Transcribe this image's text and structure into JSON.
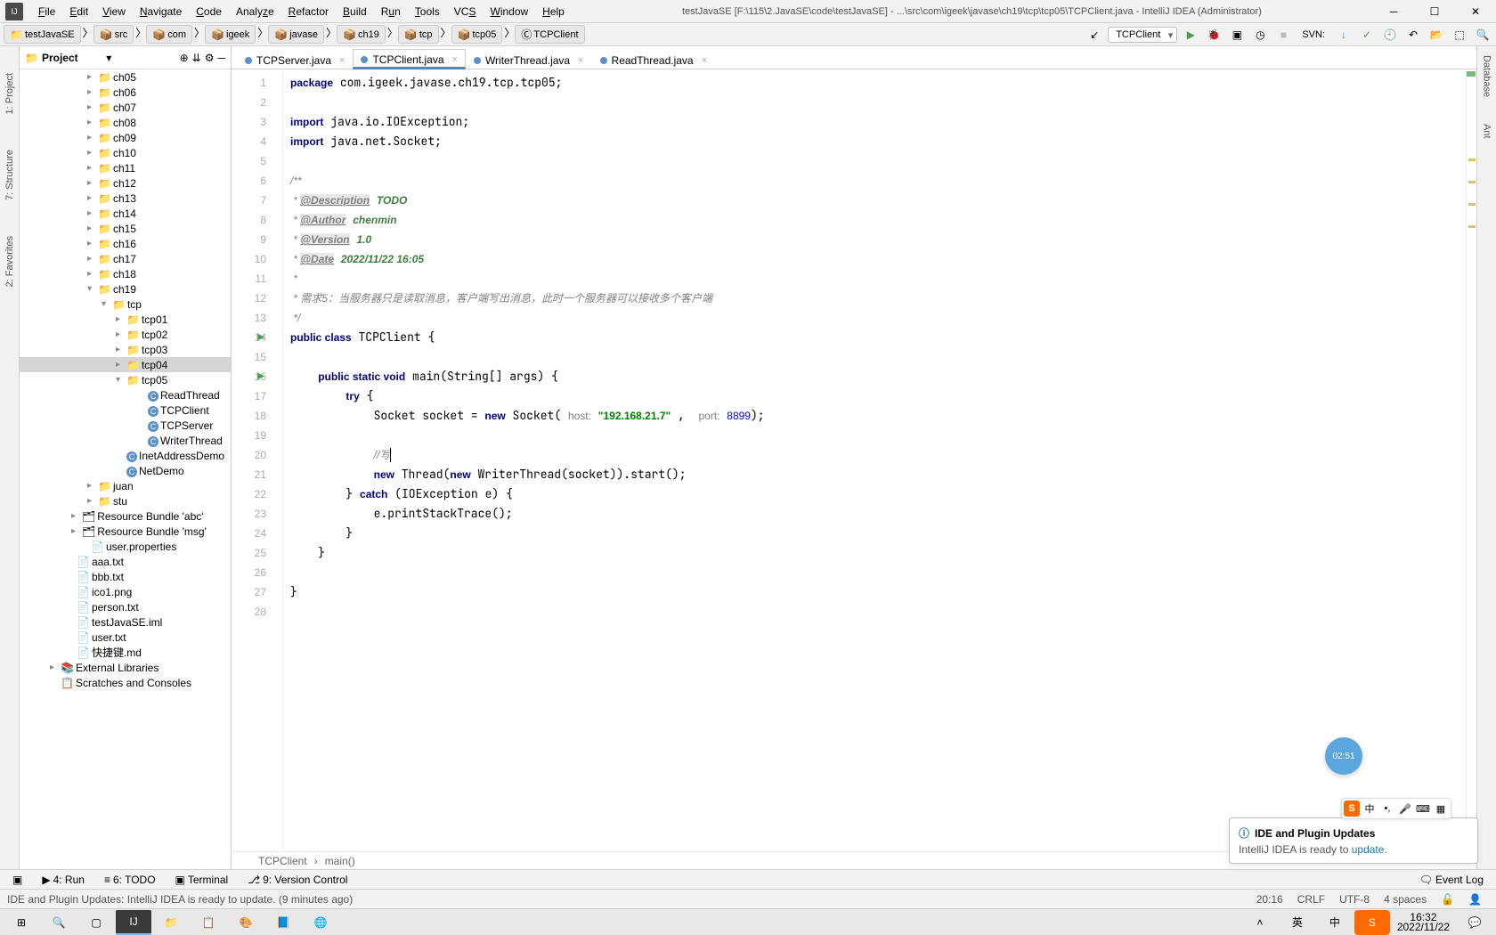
{
  "window": {
    "title": "testJavaSE [F:\\115\\2.JavaSE\\code\\testJavaSE] - ...\\src\\com\\igeek\\javase\\ch19\\tcp\\tcp05\\TCPClient.java - IntelliJ IDEA (Administrator)"
  },
  "menu": [
    "File",
    "Edit",
    "View",
    "Navigate",
    "Code",
    "Analyze",
    "Refactor",
    "Build",
    "Run",
    "Tools",
    "VCS",
    "Window",
    "Help"
  ],
  "breadcrumbs": [
    "testJavaSE",
    "src",
    "com",
    "igeek",
    "javase",
    "ch19",
    "tcp",
    "tcp05",
    "TCPClient"
  ],
  "run_config": "TCPClient",
  "svn_label": "SVN:",
  "sidebar": {
    "header": "Project",
    "tree": [
      {
        "ind": 70,
        "arrow": ">",
        "icon": "fldr",
        "label": "ch05"
      },
      {
        "ind": 70,
        "arrow": ">",
        "icon": "fldr",
        "label": "ch06"
      },
      {
        "ind": 70,
        "arrow": ">",
        "icon": "fldr",
        "label": "ch07"
      },
      {
        "ind": 70,
        "arrow": ">",
        "icon": "fldr",
        "label": "ch08"
      },
      {
        "ind": 70,
        "arrow": ">",
        "icon": "fldr",
        "label": "ch09"
      },
      {
        "ind": 70,
        "arrow": ">",
        "icon": "fldr",
        "label": "ch10"
      },
      {
        "ind": 70,
        "arrow": ">",
        "icon": "fldr",
        "label": "ch11"
      },
      {
        "ind": 70,
        "arrow": ">",
        "icon": "fldr",
        "label": "ch12"
      },
      {
        "ind": 70,
        "arrow": ">",
        "icon": "fldr",
        "label": "ch13"
      },
      {
        "ind": 70,
        "arrow": ">",
        "icon": "fldr",
        "label": "ch14"
      },
      {
        "ind": 70,
        "arrow": ">",
        "icon": "fldr",
        "label": "ch15"
      },
      {
        "ind": 70,
        "arrow": ">",
        "icon": "fldr",
        "label": "ch16"
      },
      {
        "ind": 70,
        "arrow": ">",
        "icon": "fldr",
        "label": "ch17"
      },
      {
        "ind": 70,
        "arrow": ">",
        "icon": "fldr",
        "label": "ch18"
      },
      {
        "ind": 70,
        "arrow": "v",
        "icon": "fldr",
        "label": "ch19"
      },
      {
        "ind": 86,
        "arrow": "v",
        "icon": "fldr",
        "label": "tcp"
      },
      {
        "ind": 102,
        "arrow": ">",
        "icon": "fldr",
        "label": "tcp01"
      },
      {
        "ind": 102,
        "arrow": ">",
        "icon": "fldr",
        "label": "tcp02"
      },
      {
        "ind": 102,
        "arrow": ">",
        "icon": "fldr",
        "label": "tcp03"
      },
      {
        "ind": 102,
        "arrow": ">",
        "icon": "fldr",
        "label": "tcp04",
        "sel": true
      },
      {
        "ind": 102,
        "arrow": "v",
        "icon": "fldr",
        "label": "tcp05"
      },
      {
        "ind": 126,
        "arrow": "",
        "icon": "cls",
        "label": "ReadThread"
      },
      {
        "ind": 126,
        "arrow": "",
        "icon": "cls",
        "label": "TCPClient"
      },
      {
        "ind": 126,
        "arrow": "",
        "icon": "cls",
        "label": "TCPServer"
      },
      {
        "ind": 126,
        "arrow": "",
        "icon": "cls",
        "label": "WriterThread"
      },
      {
        "ind": 102,
        "arrow": "",
        "icon": "cls",
        "label": "InetAddressDemo"
      },
      {
        "ind": 102,
        "arrow": "",
        "icon": "cls",
        "label": "NetDemo"
      },
      {
        "ind": 70,
        "arrow": ">",
        "icon": "fldr",
        "label": "juan"
      },
      {
        "ind": 70,
        "arrow": ">",
        "icon": "fldr",
        "label": "stu"
      },
      {
        "ind": 52,
        "arrow": ">",
        "icon": "bund",
        "label": "Resource Bundle 'abc'"
      },
      {
        "ind": 52,
        "arrow": ">",
        "icon": "bund",
        "label": "Resource Bundle 'msg'"
      },
      {
        "ind": 62,
        "arrow": "",
        "icon": "file",
        "label": "user.properties"
      },
      {
        "ind": 46,
        "arrow": "",
        "icon": "file",
        "label": "aaa.txt"
      },
      {
        "ind": 46,
        "arrow": "",
        "icon": "file",
        "label": "bbb.txt"
      },
      {
        "ind": 46,
        "arrow": "",
        "icon": "file",
        "label": "ico1.png"
      },
      {
        "ind": 46,
        "arrow": "",
        "icon": "file",
        "label": "person.txt"
      },
      {
        "ind": 46,
        "arrow": "",
        "icon": "file",
        "label": "testJavaSE.iml"
      },
      {
        "ind": 46,
        "arrow": "",
        "icon": "file",
        "label": "user.txt"
      },
      {
        "ind": 46,
        "arrow": "",
        "icon": "file",
        "label": "快捷键.md"
      },
      {
        "ind": 28,
        "arrow": ">",
        "icon": "lib",
        "label": "External Libraries"
      },
      {
        "ind": 28,
        "arrow": "",
        "icon": "scr",
        "label": "Scratches and Consoles"
      }
    ]
  },
  "left_vtabs": [
    "1: Project",
    "7: Structure",
    "2: Favorites"
  ],
  "right_vtabs": [
    "Database",
    "Ant"
  ],
  "editor_tabs": [
    {
      "label": "TCPServer.java",
      "active": false
    },
    {
      "label": "TCPClient.java",
      "active": true
    },
    {
      "label": "WriterThread.java",
      "active": false
    },
    {
      "label": "ReadThread.java",
      "active": false
    }
  ],
  "code": {
    "lines": [
      {
        "n": 1
      },
      {
        "n": 2
      },
      {
        "n": 3
      },
      {
        "n": 4
      },
      {
        "n": 5
      },
      {
        "n": 6
      },
      {
        "n": 7
      },
      {
        "n": 8
      },
      {
        "n": 9
      },
      {
        "n": 10
      },
      {
        "n": 11
      },
      {
        "n": 12
      },
      {
        "n": 13
      },
      {
        "n": 14,
        "run": true
      },
      {
        "n": 15
      },
      {
        "n": 16,
        "run": true
      },
      {
        "n": 17
      },
      {
        "n": 18
      },
      {
        "n": 19
      },
      {
        "n": 20
      },
      {
        "n": 21
      },
      {
        "n": 22
      },
      {
        "n": 23
      },
      {
        "n": 24
      },
      {
        "n": 25
      },
      {
        "n": 26
      },
      {
        "n": 27
      },
      {
        "n": 28
      }
    ],
    "package": "com.igeek.javase.ch19.tcp.tcp05",
    "import1": "java.io.IOException",
    "import2": "java.net.Socket",
    "doc_desc": "@Description",
    "doc_desc_v": "TODO",
    "doc_auth": "@Author",
    "doc_auth_v": "chenmin",
    "doc_ver": "@Version",
    "doc_ver_v": "1.0",
    "doc_date": "@Date",
    "doc_date_v": "2022/11/22 16:05",
    "doc_req": "需求5：当服务器只是读取消息，客户端写出消息，此时一个服务器可以接收多个客户端",
    "classname": "TCPClient",
    "host_label": "host:",
    "host_val": "\"192.168.21.7\"",
    "port_label": "port:",
    "port_val": "8899",
    "comment20": "//写",
    "breadcrumb": [
      "TCPClient",
      "main()"
    ]
  },
  "bottom_tabs": [
    "4: Run",
    "6: TODO",
    "Terminal",
    "9: Version Control"
  ],
  "event_log": "Event Log",
  "status": {
    "msg": "IDE and Plugin Updates: IntelliJ IDEA is ready to update. (9 minutes ago)",
    "pos": "20:16",
    "sep": "CRLF",
    "enc": "UTF-8",
    "indent": "4 spaces"
  },
  "notif": {
    "title": "IDE and Plugin Updates",
    "body_pre": "IntelliJ IDEA is ready to ",
    "body_link": "update",
    "body_post": "."
  },
  "timer": "02:51",
  "ime_lang": "中",
  "taskbar": {
    "time": "16:32",
    "date": "2022/11/22",
    "tray_lang": "中",
    "tray_ime": "英"
  }
}
